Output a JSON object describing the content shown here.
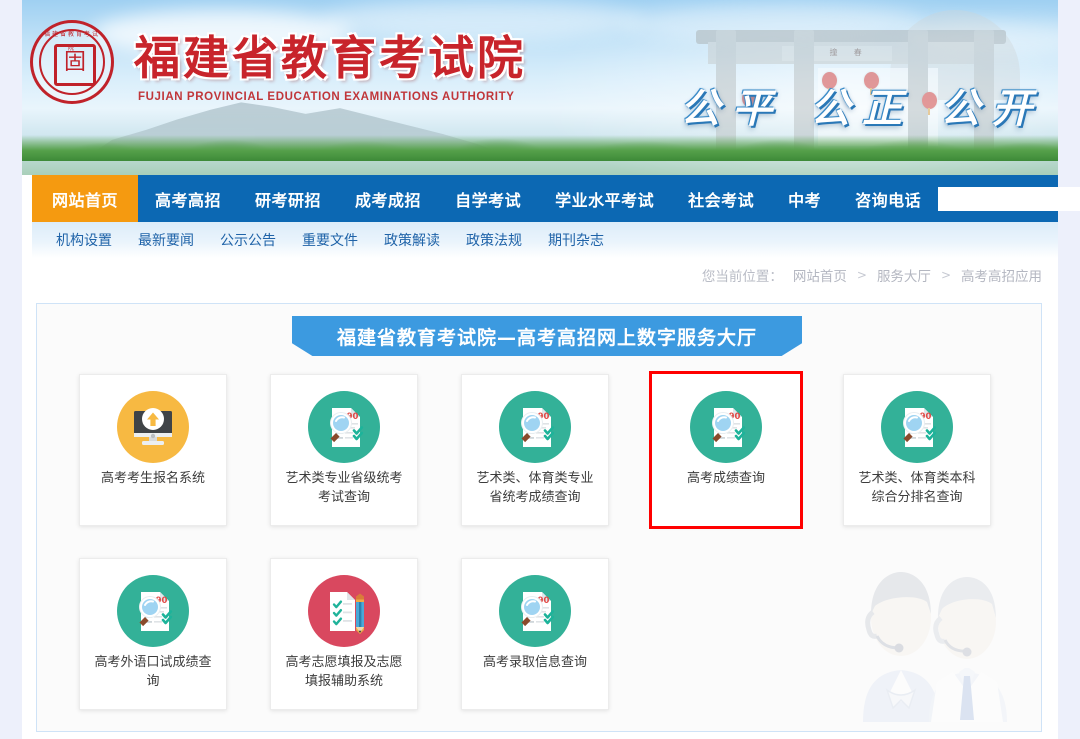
{
  "site": {
    "title_cn": "福建省教育考试院",
    "title_en": "FUJIAN PROVINCIAL EDUCATION EXAMINATIONS AUTHORITY",
    "slogan": "公平 公正 公开",
    "seal_arc": "福建省教育考试院",
    "seal_char": "闽",
    "archway_plaque": "防 撞 春"
  },
  "nav": {
    "items": [
      {
        "label": "网站首页",
        "active": true
      },
      {
        "label": "高考高招",
        "active": false
      },
      {
        "label": "研考研招",
        "active": false
      },
      {
        "label": "成考成招",
        "active": false
      },
      {
        "label": "自学考试",
        "active": false
      },
      {
        "label": "学业水平考试",
        "active": false
      },
      {
        "label": "社会考试",
        "active": false
      },
      {
        "label": "中考",
        "active": false
      },
      {
        "label": "咨询电话",
        "active": false
      }
    ],
    "search": {
      "value": "",
      "placeholder": "",
      "icon": "search-icon"
    },
    "active_bg": "#f59a10",
    "bar_bg": "#0c68b3"
  },
  "subnav": {
    "items": [
      "机构设置",
      "最新要闻",
      "公示公告",
      "重要文件",
      "政策解读",
      "政策法规",
      "期刊杂志"
    ]
  },
  "breadcrumb": {
    "prefix": "您当前位置：",
    "items": [
      "网站首页",
      "服务大厅",
      "高考高招应用"
    ],
    "separator": ">"
  },
  "panel": {
    "ribbon_title": "福建省教育考试院—高考高招网上数字服务大厅",
    "ribbon_color": "#3c9ae0",
    "selected_outline_color": "#ff0000",
    "rows": [
      [
        {
          "label": "高考考生报名系统",
          "icon": "monitor-upload-icon",
          "icon_color": "#f7b942",
          "selected": false
        },
        {
          "label": "艺术类专业省级统考考试查询",
          "icon": "document-search-icon",
          "icon_color": "#33b198",
          "selected": false
        },
        {
          "label": "艺术类、体育类专业省统考成绩查询",
          "icon": "document-search-icon",
          "icon_color": "#33b198",
          "selected": false
        },
        {
          "label": "高考成绩查询",
          "icon": "document-search-icon",
          "icon_color": "#33b198",
          "selected": true
        },
        {
          "label": "艺术类、体育类本科综合分排名查询",
          "icon": "document-search-icon",
          "icon_color": "#33b198",
          "selected": false
        }
      ],
      [
        {
          "label": "高考外语口试成绩查询",
          "icon": "document-search-icon",
          "icon_color": "#33b198",
          "selected": false
        },
        {
          "label": "高考志愿填报及志愿填报辅助系统",
          "icon": "form-pencil-icon",
          "icon_color": "#d9485f",
          "selected": false
        },
        {
          "label": "高考录取信息查询",
          "icon": "document-search-icon",
          "icon_color": "#33b198",
          "selected": false
        }
      ]
    ],
    "icon_score_badge": "90",
    "watermark": "customer-service-agents-watermark"
  }
}
